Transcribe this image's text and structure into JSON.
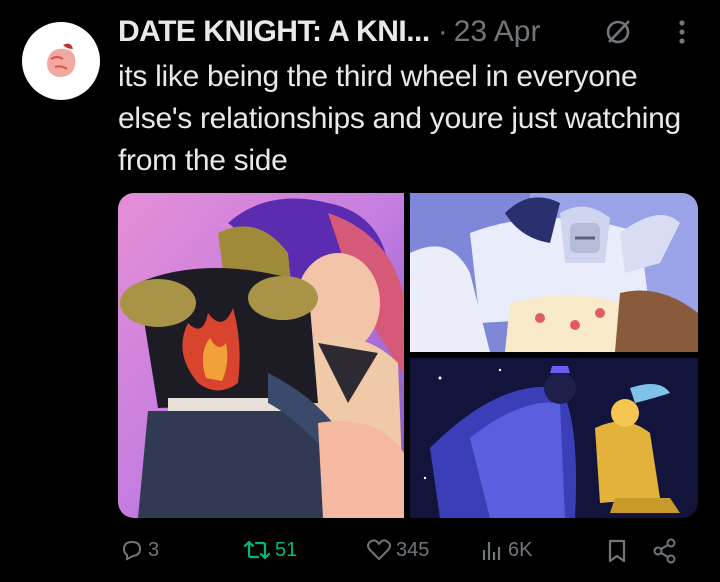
{
  "post": {
    "author_name": "DATE KNIGHT: A KNI...",
    "separator": "·",
    "date": "23 Apr",
    "text": "its like being the third wheel in everyone else's relationships and youre just watching from the side"
  },
  "media": {
    "image_count": 3
  },
  "actions": {
    "replies": "3",
    "retweets": "51",
    "likes": "345",
    "views": "6K"
  },
  "colors": {
    "background": "#000000",
    "text_primary": "#e7e9ea",
    "text_secondary": "#71767b",
    "retweet_green": "#00ba7c"
  },
  "icons": [
    "avatar-logo",
    "no-sign-icon",
    "more-options-icon",
    "reply-icon",
    "retweet-icon",
    "like-icon",
    "views-icon",
    "bookmark-icon",
    "share-icon"
  ]
}
